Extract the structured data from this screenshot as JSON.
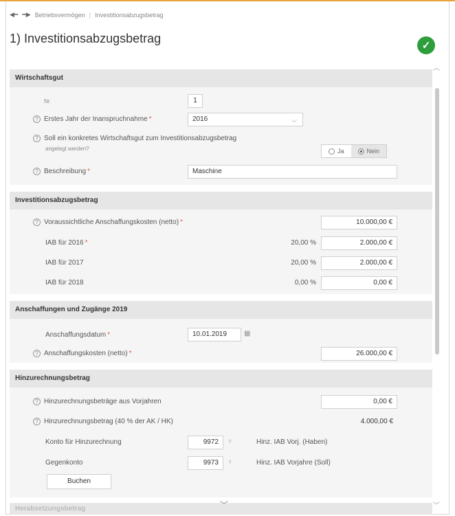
{
  "breadcrumb": {
    "items": [
      "Betriebsvermögen",
      "Investitionsabzugsbetrag"
    ]
  },
  "page": {
    "title": "1) Investitionsabzugsbetrag",
    "status_icon": "check-icon"
  },
  "sections": {
    "wirtschaftsgut": {
      "header": "Wirtschaftsgut",
      "nr_label": "Nr.",
      "nr_value": "1",
      "erstes_jahr_label": "Erstes Jahr der Inanspruchnahme",
      "erstes_jahr_value": "2016",
      "konkret_label": "Soll ein konkretes Wirtschaftsgut zum Investitionsabzugsbetrag",
      "konkret_sublabel": "angelegt werden?",
      "radio_ja": "Ja",
      "radio_nein": "Nein",
      "beschreibung_label": "Beschreibung",
      "beschreibung_value": "Maschine"
    },
    "iab": {
      "header": "Investitionsabzugsbetrag",
      "kosten_label": "Voraussichtliche Anschaffungskosten (netto)",
      "kosten_value": "10.000,00 €",
      "rows": [
        {
          "label": "IAB für 2016",
          "required": true,
          "pct": "20,00 %",
          "value": "2.000,00 €"
        },
        {
          "label": "IAB für 2017",
          "required": false,
          "pct": "20,00 %",
          "value": "2.000,00 €"
        },
        {
          "label": "IAB für 2018",
          "required": false,
          "pct": "0,00 %",
          "value": "0,00 €"
        }
      ]
    },
    "anschaffungen": {
      "header": "Anschaffungen und Zugänge 2019",
      "datum_label": "Anschaffungsdatum",
      "datum_value": "10.01.2019",
      "kosten_label": "Anschaffungskosten (netto)",
      "kosten_value": "26.000,00 €"
    },
    "hinzurechnung": {
      "header": "Hinzurechnungsbetrag",
      "vorjahre_label": "Hinzurechnungsbeträge aus Vorjahren",
      "vorjahre_value": "0,00 €",
      "betrag_label": "Hinzurechnungsbetrag (40 % der AK / HK)",
      "betrag_value": "4.000,00 €",
      "konto_label": "Konto für Hinzurechnung",
      "konto_value": "9972",
      "konto_desc": "Hinz. IAB Vorj. (Haben)",
      "gegenkonto_label": "Gegenkonto",
      "gegenkonto_value": "9973",
      "gegenkonto_desc": "Hinz. IAB Vorjahre (Soll)",
      "buchen_label": "Buchen"
    },
    "collapsed": {
      "header": "Herabsetzungsbetrag"
    }
  }
}
